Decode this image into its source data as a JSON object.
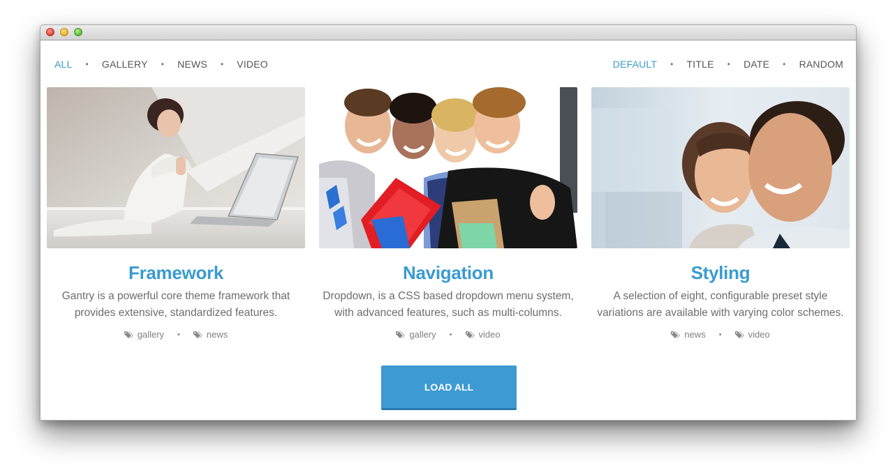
{
  "filters": {
    "items": [
      "ALL",
      "GALLERY",
      "NEWS",
      "VIDEO"
    ],
    "active": "ALL"
  },
  "sort": {
    "items": [
      "DEFAULT",
      "TITLE",
      "DATE",
      "RANDOM"
    ],
    "active": "DEFAULT"
  },
  "cards": [
    {
      "title": "Framework",
      "description": "Gantry is a powerful core theme framework that provides extensive, standardized features.",
      "tags": [
        "gallery",
        "news"
      ]
    },
    {
      "title": "Navigation",
      "description": "Dropdown, is a CSS based dropdown menu system, with advanced features, such as multi-columns.",
      "tags": [
        "gallery",
        "video"
      ]
    },
    {
      "title": "Styling",
      "description": "A selection of eight, configurable preset style variations are available with varying color schemes.",
      "tags": [
        "news",
        "video"
      ]
    }
  ],
  "load_button": "LOAD ALL",
  "colors": {
    "accent": "#3a9bd1",
    "button": "#3d9ad3",
    "text": "#6d6d6d"
  },
  "icons": {
    "tag": "tags-icon"
  }
}
